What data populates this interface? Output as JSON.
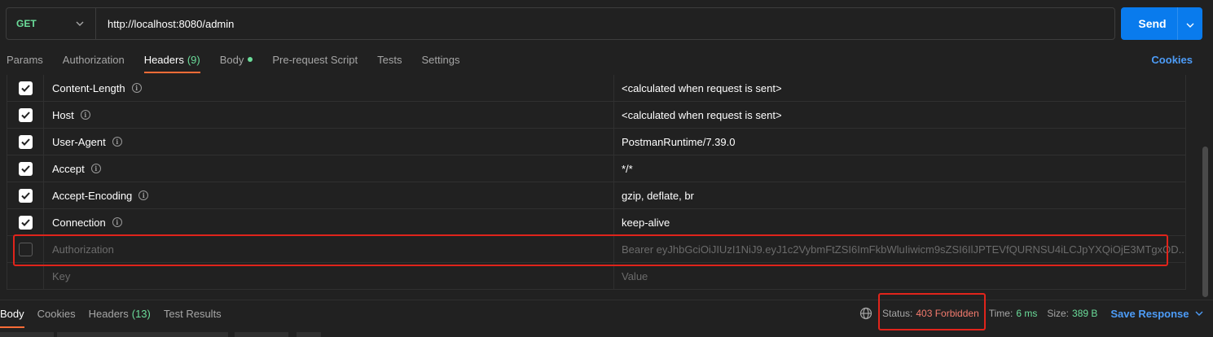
{
  "request": {
    "method": "GET",
    "url": "http://localhost:8080/admin",
    "send_label": "Send"
  },
  "request_tabs": [
    {
      "label": "Params",
      "active": false
    },
    {
      "label": "Authorization",
      "active": false
    },
    {
      "label": "Headers",
      "count": "(9)",
      "active": true
    },
    {
      "label": "Body",
      "has_dot": true,
      "active": false
    },
    {
      "label": "Pre-request Script",
      "active": false
    },
    {
      "label": "Tests",
      "active": false
    },
    {
      "label": "Settings",
      "active": false
    }
  ],
  "cookies_label": "Cookies",
  "headers": [
    {
      "key": "Content-Length",
      "value": "<calculated when request is sent>",
      "checked": true,
      "info": true
    },
    {
      "key": "Host",
      "value": "<calculated when request is sent>",
      "checked": true,
      "info": true
    },
    {
      "key": "User-Agent",
      "value": "PostmanRuntime/7.39.0",
      "checked": true,
      "info": true
    },
    {
      "key": "Accept",
      "value": "*/*",
      "checked": true,
      "info": true
    },
    {
      "key": "Accept-Encoding",
      "value": "gzip, deflate, br",
      "checked": true,
      "info": true
    },
    {
      "key": "Connection",
      "value": "keep-alive",
      "checked": true,
      "info": true
    },
    {
      "key": "Authorization",
      "value": "Bearer eyJhbGciOiJIUzI1NiJ9.eyJ1c2VybmFtZSI6ImFkbWluIiwicm9sZSI6IlJPTEVfQURNSU4iLCJpYXQiOjE3MTgxOD...",
      "checked": false,
      "info": false
    }
  ],
  "new_row": {
    "key_placeholder": "Key",
    "value_placeholder": "Value"
  },
  "response_tabs": [
    {
      "label": "Body",
      "active": true
    },
    {
      "label": "Cookies",
      "active": false
    },
    {
      "label": "Headers",
      "count": "(13)",
      "active": false
    },
    {
      "label": "Test Results",
      "active": false
    }
  ],
  "response_meta": {
    "status_label": "Status:",
    "status_value": "403 Forbidden",
    "time_label": "Time:",
    "time_value": "6 ms",
    "size_label": "Size:",
    "size_value": "389 B",
    "save_label": "Save Response"
  },
  "colors": {
    "accent_orange": "#ff6c37",
    "send_blue": "#097bed",
    "link_blue": "#4d9cf7",
    "success_green": "#6bdd9a",
    "error_red": "#f47b6e",
    "annotation_red": "#e0241b"
  },
  "icons": {
    "method_dropdown": "chevron-down-icon",
    "send_dropdown": "chevron-down-icon",
    "info": "info-icon",
    "check": "check-icon",
    "network": "globe-icon",
    "save_dropdown": "chevron-down-icon"
  }
}
